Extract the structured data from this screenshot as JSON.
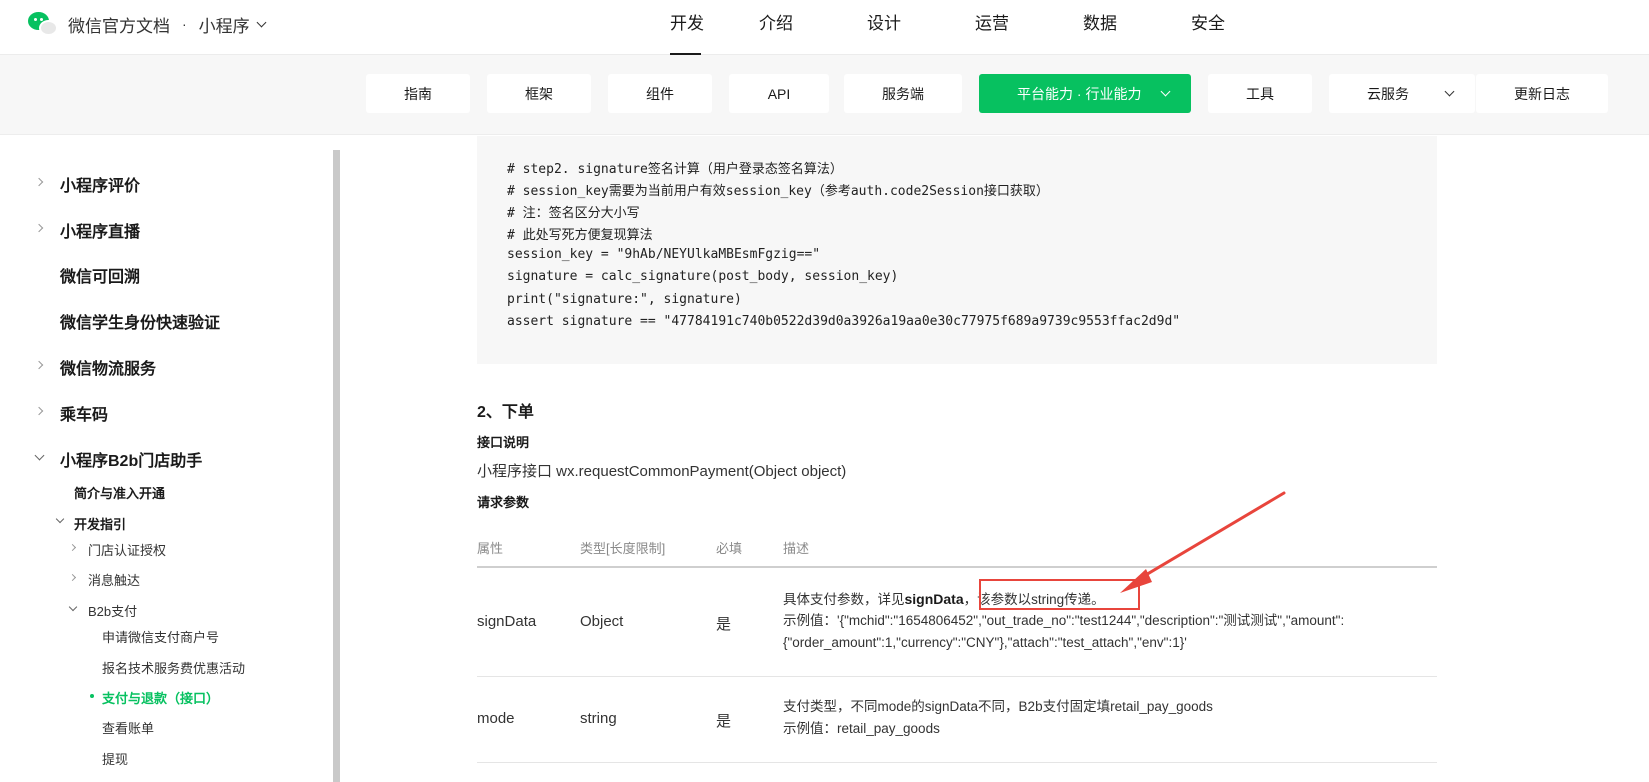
{
  "header": {
    "brand_title": "微信官方文档",
    "brand_sep": "·",
    "brand_sub": "小程序",
    "nav": [
      "开发",
      "介绍",
      "设计",
      "运营",
      "数据",
      "安全"
    ]
  },
  "subnav": {
    "items": [
      "指南",
      "框架",
      "组件",
      "API",
      "服务端",
      "平台能力 · 行业能力",
      "工具",
      "云服务",
      "更新日志"
    ]
  },
  "sidebar": {
    "top_items": [
      "小程序评价",
      "小程序直播",
      "微信可回溯",
      "微信学生身份快速验证",
      "微信物流服务",
      "乘车码",
      "小程序B2b门店助手"
    ],
    "intro": "简介与准入开通",
    "dev_guide": "开发指引",
    "store_auth": "门店认证授权",
    "msg_reach": "消息触达",
    "b2b_pay": "B2b支付",
    "apply_merchant": "申请微信支付商户号",
    "signup_activity": "报名技术服务费优惠活动",
    "pay_refund": "支付与退款（接口）",
    "view_bill": "查看账单",
    "withdraw": "提现"
  },
  "code": {
    "lines": [
      "# step2. signature签名计算（用户登录态签名算法）",
      "# session_key需要为当前用户有效session_key（参考auth.code2Session接口获取）",
      "# 注：签名区分大小写",
      "# 此处写死方便复现算法",
      "session_key = \"9hAb/NEYUlkaMBEsmFgzig==\"",
      "signature = calc_signature(post_body, session_key)",
      "print(\"signature:\", signature)",
      "assert signature == \"47784191c740b0522d39d0a3926a19aa0e30c77975f689a9739c9553ffac2d9d\""
    ]
  },
  "content": {
    "section_title": "2、下单",
    "api_desc_label": "接口说明",
    "api_desc": "小程序接口 wx.requestCommonPayment(Object object)",
    "params_label": "请求参数",
    "table": {
      "headers": [
        "属性",
        "类型[长度限制]",
        "必填",
        "描述"
      ],
      "rows": [
        {
          "attr": "signData",
          "type": "Object",
          "required": "是",
          "desc_pre": "具体支付参数，详见",
          "desc_bold": "signData",
          "desc_comma": "，",
          "desc_highlight": "该参数以string传递。",
          "example_1": "示例值：'{\"mchid\":\"1654806452\",\"out_trade_no\":\"test1244\",\"description\":\"测试测试\",\"amount\":",
          "example_2": "{\"order_amount\":1,\"currency\":\"CNY\"},\"attach\":\"test_attach\",\"env\":1}'"
        },
        {
          "attr": "mode",
          "type": "string",
          "required": "是",
          "desc_1": "支付类型，不同mode的signData不同，B2b支付固定填retail_pay_goods",
          "desc_2": "示例值：retail_pay_goods"
        }
      ]
    }
  },
  "colors": {
    "brand_green": "#07c160",
    "annotation_red": "#e8453c"
  }
}
